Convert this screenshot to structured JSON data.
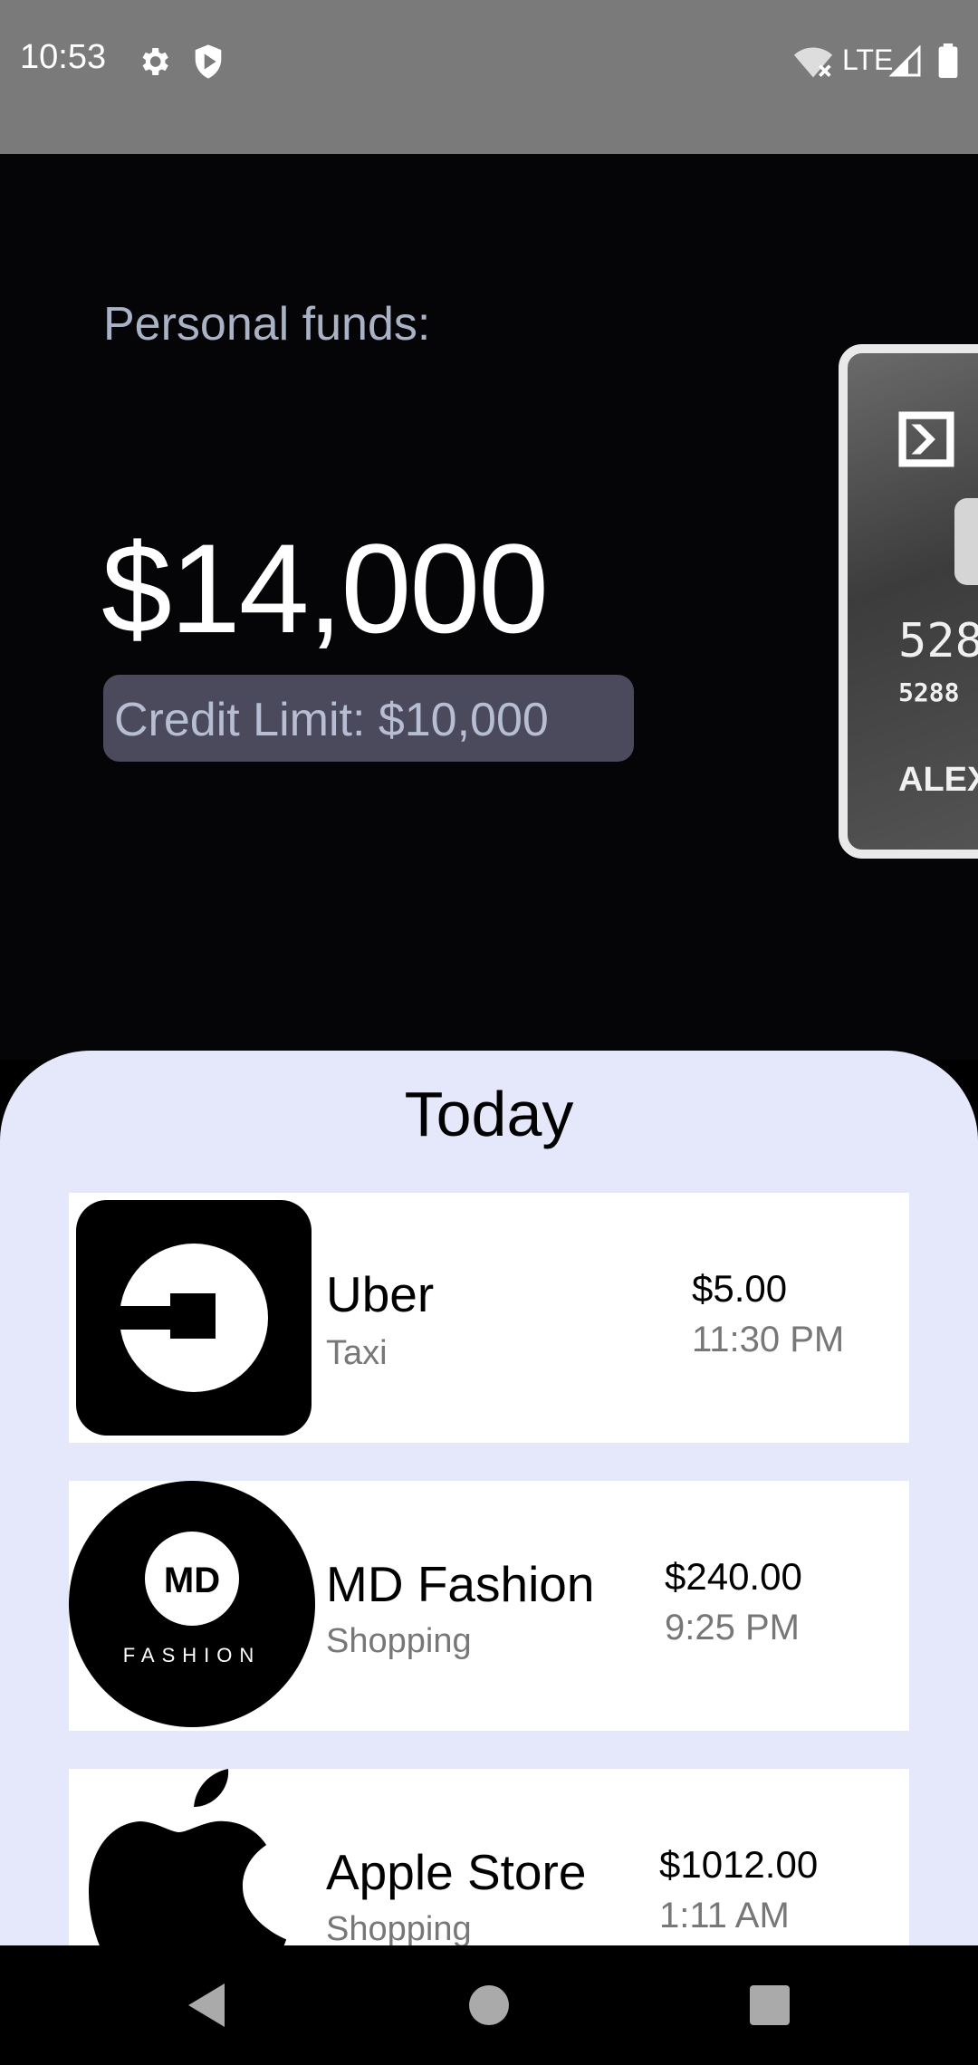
{
  "status_bar": {
    "time": "10:53",
    "network": "LTE"
  },
  "hero": {
    "funds_label": "Personal funds:",
    "funds_amount": "$14,000",
    "credit_limit": "Credit Limit: $10,000"
  },
  "card": {
    "number_line1": "528",
    "number_line2": "5288",
    "holder": "ALEX"
  },
  "transactions": {
    "title": "Today",
    "items": [
      {
        "name": "Uber",
        "category": "Taxi",
        "amount": "$5.00",
        "time": "11:30 PM",
        "logo": "uber-logo"
      },
      {
        "name": "MD Fashion",
        "category": "Shopping",
        "amount": "$240.00",
        "time": "9:25 PM",
        "logo": "md-fashion-logo",
        "logo_text_top": "MD",
        "logo_text_bottom": "FASHION"
      },
      {
        "name": "Apple Store",
        "category": "Shopping",
        "amount": "$1012.00",
        "time": "1:11 AM",
        "logo": "apple-logo"
      }
    ]
  },
  "colors": {
    "hero_bg": "#050407",
    "sheet_bg": "#e5e8fa",
    "credit_pill": "#4a4a5c",
    "label_text": "#aab2c6"
  }
}
